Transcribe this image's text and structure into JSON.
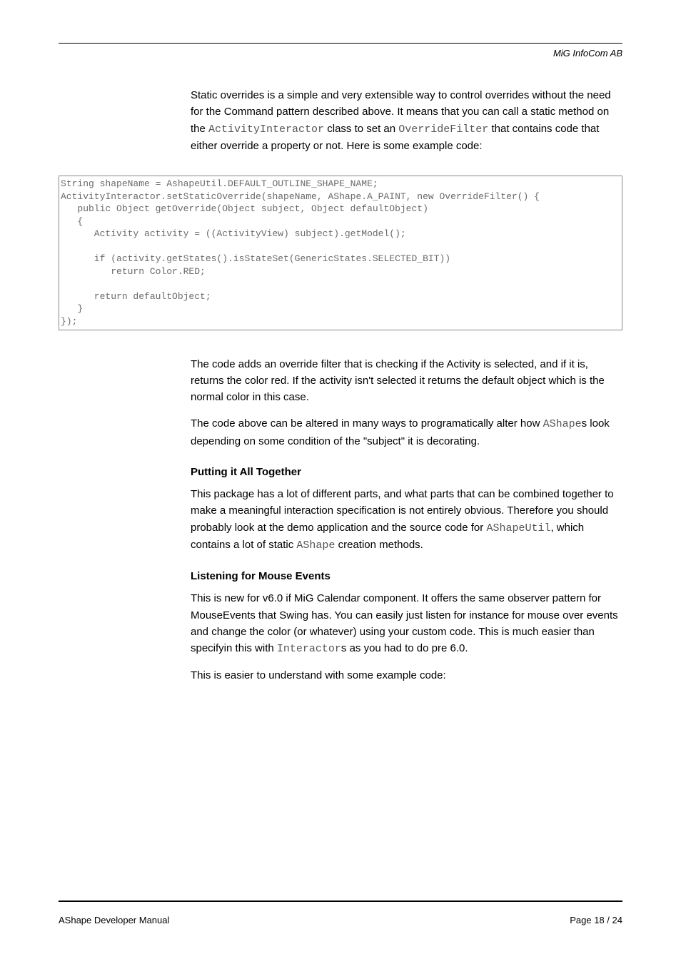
{
  "header": {
    "company": "MiG InfoCom AB"
  },
  "intro": {
    "p1a": "Static overrides is a simple and very extensible way to control overrides without the need for the Command pattern described above. It means that you can call a static method on the ",
    "code1": "ActivityInteractor",
    "p1b": " class to set an ",
    "code2": "OverrideFilter",
    "p1c": " that contains code that either override a property or not. Here is some example code:"
  },
  "code_block": "String shapeName = AshapeUtil.DEFAULT_OUTLINE_SHAPE_NAME;\nActivityInteractor.setStaticOverride(shapeName, AShape.A_PAINT, new OverrideFilter() {\n   public Object getOverride(Object subject, Object defaultObject)\n   {\n      Activity activity = ((ActivityView) subject).getModel();\n\n      if (activity.getStates().isStateSet(GenericStates.SELECTED_BIT))\n         return Color.RED;\n\n      return defaultObject;\n   }\n});",
  "after_code": {
    "p1": "The code adds an override filter that is checking if the Activity is selected, and if it is, returns the color red. If the activity isn't selected it returns the default object which is the normal color in this case.",
    "p2a": "The code above can be altered in many ways to programatically alter how ",
    "p2code": "AShape",
    "p2b": "s look depending on some condition of the \"subject\" it is decorating."
  },
  "putting": {
    "title": "Putting it All Together",
    "p1a": "This package has a lot of different parts, and what parts that can be combined together to make a meaningful interaction specification is not entirely obvious. Therefore you should probably look at the demo application and the source code for ",
    "code1": "AShapeUtil",
    "p1b": ", which contains a lot of static ",
    "code2": "AShape",
    "p1c": " creation methods."
  },
  "listening": {
    "title": "Listening for Mouse Events",
    "p1a": "This is new for v6.0 if MiG Calendar component. It offers the same observer pattern for MouseEvents that Swing has. You can easily just listen for instance for mouse over events and change the color (or whatever) using your custom code. This is much easier than specifyin this with ",
    "code1": "Interactor",
    "p1b": "s as you had to do pre 6.0.",
    "p2": "This is easier to understand with some example code:"
  },
  "footer": {
    "left": "AShape Developer Manual",
    "right": "Page 18 / 24"
  }
}
